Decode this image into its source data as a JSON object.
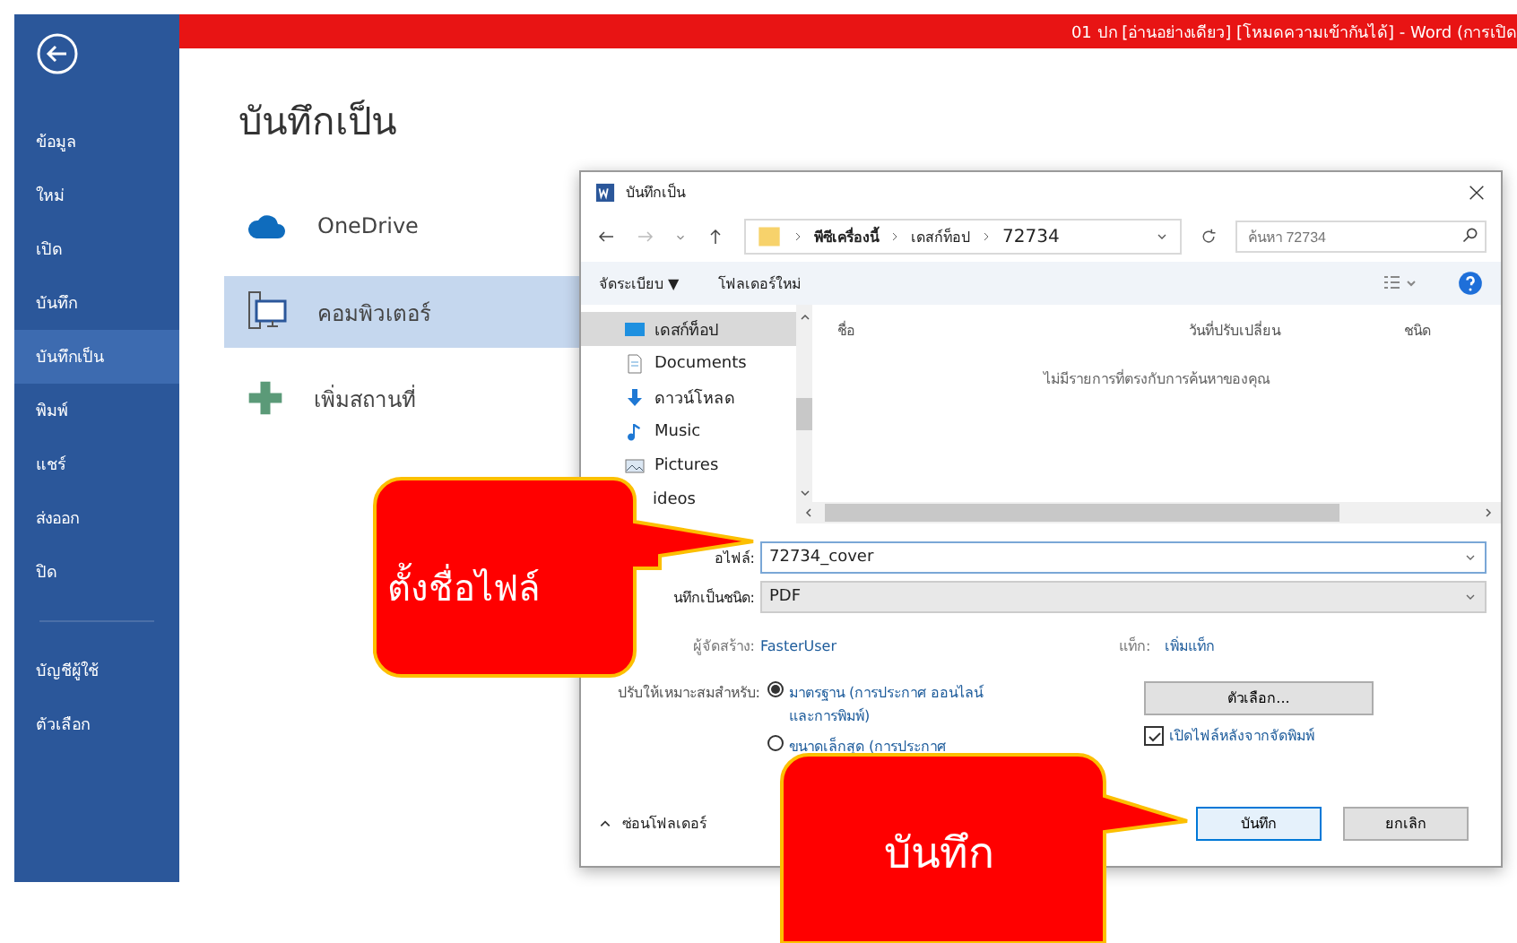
{
  "window": {
    "title": "01 ปก [อ่านอย่างเดียว] [โหมดความเข้ากันได้] - Word (การเปิด"
  },
  "sidebar": {
    "items": [
      {
        "label": "ข้อมูล",
        "selected": false
      },
      {
        "label": "ใหม่",
        "selected": false
      },
      {
        "label": "เปิด",
        "selected": false
      },
      {
        "label": "บันทึก",
        "selected": false
      },
      {
        "label": "บันทึกเป็น",
        "selected": true
      },
      {
        "label": "พิมพ์",
        "selected": false
      },
      {
        "label": "แชร์",
        "selected": false
      },
      {
        "label": "ส่งออก",
        "selected": false
      },
      {
        "label": "ปิด",
        "selected": false
      }
    ],
    "account_items": [
      {
        "label": "บัญชีผู้ใช้",
        "selected": false
      },
      {
        "label": "ตัวเลือก",
        "selected": false
      }
    ]
  },
  "page_title": "บันทึกเป็น",
  "locations": [
    {
      "kind": "cloud",
      "label": "OneDrive",
      "selected": false
    },
    {
      "kind": "computer",
      "label": "คอมพิวเตอร์",
      "selected": true
    },
    {
      "kind": "add",
      "label": "เพิ่มสถานที่",
      "selected": false
    }
  ],
  "dialog": {
    "title": "บันทึกเป็น",
    "address": [
      "พีซีเครื่องนี้",
      "เดสก์ท็อป",
      "72734"
    ],
    "search": {
      "placeholder": "ค้นหา 72734"
    },
    "toolbar": {
      "organize": "จัดระเบียบ ▼",
      "new_folder": "โฟลเดอร์ใหม่"
    },
    "tree": [
      {
        "kind": "desktop",
        "label": "เดสก์ท็อป",
        "selected": true
      },
      {
        "kind": "documents",
        "label": "Documents",
        "selected": false
      },
      {
        "kind": "download",
        "label": "ดาวน์โหลด",
        "selected": false
      },
      {
        "kind": "music",
        "label": "Music",
        "selected": false
      },
      {
        "kind": "pictures",
        "label": "Pictures",
        "selected": false
      },
      {
        "kind": "videos",
        "label": "ideos",
        "selected": false
      }
    ],
    "columns": [
      "ชื่อ",
      "วันที่ปรับเปลี่ยน",
      "ชนิด"
    ],
    "empty_message": "ไม่มีรายการที่ตรงกับการค้นหาของคุณ",
    "file_name": {
      "label": "อไฟล์:",
      "value": "72734_cover"
    },
    "file_type": {
      "label": "นทึกเป็นชนิด:",
      "value": "PDF"
    },
    "author": {
      "label": "ผู้จัดสร้าง:",
      "value": "FasterUser"
    },
    "tags": {
      "label": "แท็ก:",
      "value": "เพิ่มแท็ก"
    },
    "optimize": {
      "label": "ปรับให้เหมาะสมสำหรับ:",
      "options": [
        {
          "label": "มาตรฐาน (การประกาศ ออนไลน์และการพิมพ์)",
          "selected": true
        },
        {
          "label": "ขนาดเล็กสุด (การประกาศ",
          "selected": false
        }
      ]
    },
    "options_button": "ตัวเลือก...",
    "open_after": {
      "label": "เปิดไฟล์หลังจากจัดพิมพ์",
      "checked": true
    },
    "hide_folders": "ซ่อนโฟลเดอร์",
    "buttons": [
      "บันทึก",
      "ยกเลิก"
    ]
  },
  "callouts": [
    {
      "kind": "filename",
      "text": "ตั้งชื่อไฟล์"
    },
    {
      "kind": "save",
      "text": "บันทึก"
    }
  ]
}
